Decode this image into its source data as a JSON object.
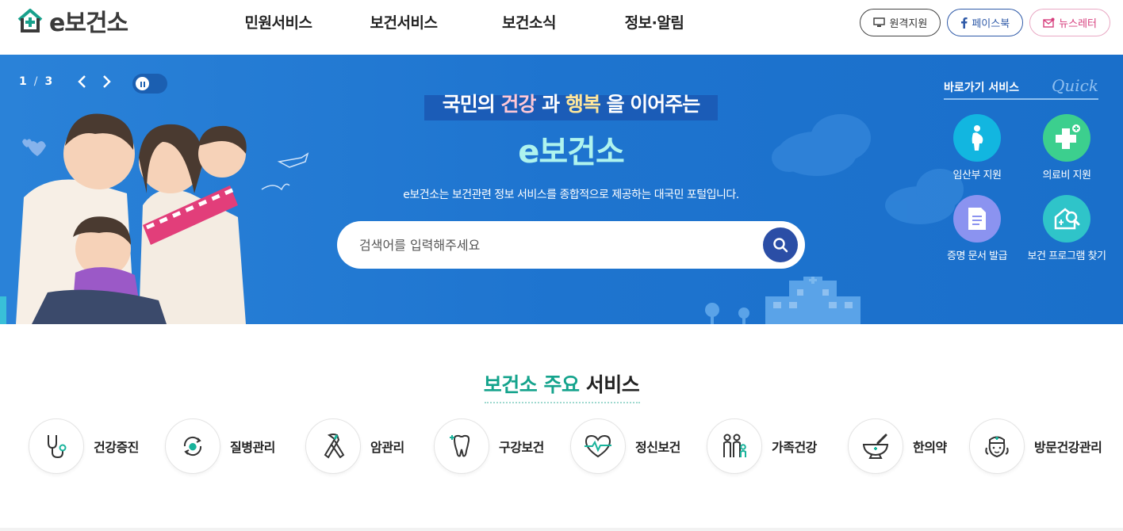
{
  "header": {
    "logo_text": "e보건소",
    "nav": [
      "민원서비스",
      "보건서비스",
      "보건소식",
      "정보·알림"
    ],
    "util": {
      "remote_label": "원격지원",
      "facebook_label": "페이스북",
      "newsletter_label": "뉴스레터"
    }
  },
  "hero": {
    "pager": {
      "current": "1",
      "separator": "/",
      "total": "3"
    },
    "title_pre": "국민의 ",
    "title_kw1": "건강",
    "title_mid": " 과 ",
    "title_kw2": "행복",
    "title_post": " 을 이어주는",
    "brand": "e보건소",
    "subtitle": "e보건소는 보건관련 정보 서비스를 종합적으로 제공하는 대국민 포털입니다.",
    "search_placeholder": "검색어를 입력해주세요",
    "quick": {
      "title": "바로가기 서비스",
      "script": "Quick",
      "items": [
        {
          "label": "임산부 지원",
          "icon": "pregnant-icon",
          "color": "#12b6e0"
        },
        {
          "label": "의료비 지원",
          "icon": "medical-cross-icon",
          "color": "#3ccf8e"
        },
        {
          "label": "증명 문서 발급",
          "icon": "document-icon",
          "color": "#8b93f0"
        },
        {
          "label": "보건 프로그램 찾기",
          "icon": "house-search-icon",
          "color": "#2fc4c9"
        }
      ]
    }
  },
  "services": {
    "title_hl": "보건소 주요",
    "title_rest": " 서비스",
    "items": [
      {
        "label": "건강증진",
        "icon": "stethoscope-icon"
      },
      {
        "label": "질병관리",
        "icon": "pill-cycle-icon"
      },
      {
        "label": "암관리",
        "icon": "ribbon-icon"
      },
      {
        "label": "구강보건",
        "icon": "tooth-icon"
      },
      {
        "label": "정신보건",
        "icon": "heart-pulse-icon"
      },
      {
        "label": "가족건강",
        "icon": "family-icon"
      },
      {
        "label": "한의약",
        "icon": "mortar-icon"
      },
      {
        "label": "방문건강관리",
        "icon": "nurse-icon"
      }
    ]
  },
  "colors": {
    "hero_blue": "#1f78d1",
    "accent_green": "#14a38c",
    "search_button": "#2b4ea6"
  }
}
